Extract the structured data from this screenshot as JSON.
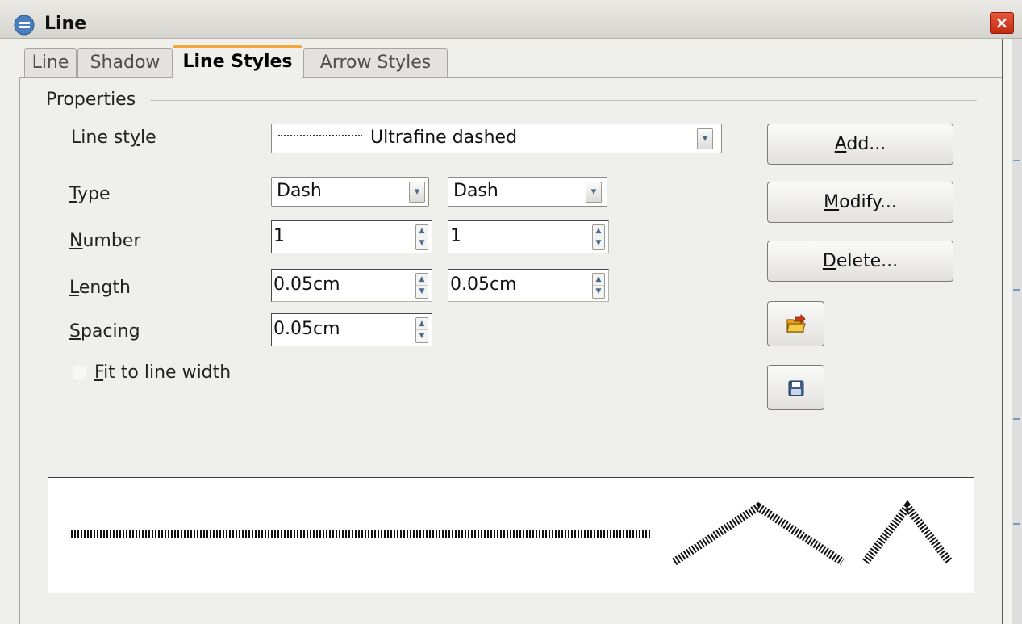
{
  "window": {
    "title": "Line",
    "close_symbol": "×"
  },
  "tabs": [
    {
      "label": "Line",
      "active": false
    },
    {
      "label": "Shadow",
      "active": false
    },
    {
      "label": "Line Styles",
      "active": true
    },
    {
      "label": "Arrow Styles",
      "active": false
    }
  ],
  "properties": {
    "frame_title": "Properties",
    "line_style": {
      "label_pre": "Line st",
      "label_mnemonic": "y",
      "label_post": "le",
      "value": "Ultrafine dashed"
    },
    "type": {
      "label_mnemonic": "T",
      "label_post": "ype",
      "value_1": "Dash",
      "value_2": "Dash"
    },
    "number": {
      "label_mnemonic": "N",
      "label_post": "umber",
      "value_1": "1",
      "value_2": "1"
    },
    "length": {
      "label_mnemonic": "L",
      "label_post": "ength",
      "value_1": "0.05cm",
      "value_2": "0.05cm"
    },
    "spacing": {
      "label_mnemonic": "S",
      "label_post": "pacing",
      "value": "0.05cm"
    },
    "fit_to_line_width": {
      "label_mnemonic": "F",
      "label_post": "it to line width",
      "checked": false
    }
  },
  "buttons": {
    "add": {
      "mnemonic": "A",
      "rest": "dd..."
    },
    "modify": {
      "mnemonic": "M",
      "rest": "odify..."
    },
    "delete": {
      "mnemonic": "D",
      "rest": "elete..."
    },
    "load_icon": "open-folder-icon",
    "save_icon": "save-icon"
  },
  "colors": {
    "accent_tab": "#f3a73b",
    "close_button": "#d13a1b",
    "dropdown_arrow": "#4b6a8c"
  }
}
